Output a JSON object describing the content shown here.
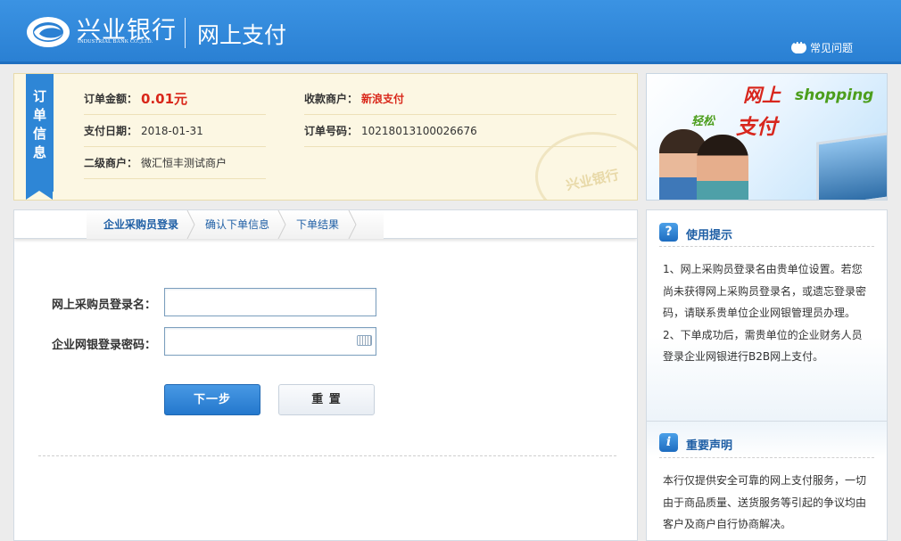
{
  "header": {
    "logo_cn": "兴业银行",
    "logo_en": "INDUSTRIAL BANK CO.,LTD.",
    "title": "网上支付",
    "help_label": "常见问题"
  },
  "order": {
    "ribbon_label": "订单信息",
    "amount_label": "订单金额：",
    "amount_value": "0.01元",
    "merchant_label": "收款商户：",
    "merchant_value": "新浪支付",
    "date_label": "支付日期：",
    "date_value": "2018-01-31",
    "order_no_label": "订单号码：",
    "order_no_value": "10218013100026676",
    "sub_merchant_label": "二级商户：",
    "sub_merchant_value": "微汇恒丰测试商户",
    "stamp_text": "兴业银行"
  },
  "banner": {
    "line1_cn": "网上",
    "line1_en": "shopping",
    "line2_small": "轻松",
    "line2_big": "支付"
  },
  "tabs": [
    {
      "label": "企业采购员登录",
      "active": true
    },
    {
      "label": "确认下单信息",
      "active": false
    },
    {
      "label": "下单结果",
      "active": false
    }
  ],
  "form": {
    "username_label": "网上采购员登录名：",
    "username_value": "",
    "password_label": "企业网银登录密码：",
    "password_value": "",
    "next_button": "下一步",
    "reset_button": "重 置"
  },
  "tips": {
    "title": "使用提示",
    "icon": "question-icon",
    "lines": [
      "1、网上采购员登录名由贵单位设置。若您",
      "尚未获得网上采购员登录名，或遗忘登录密",
      "码，请联系贵单位企业网银管理员办理。",
      "2、下单成功后，需贵单位的企业财务人员",
      "登录企业网银进行B2B网上支付。"
    ]
  },
  "notice": {
    "title": "重要声明",
    "icon": "info-icon",
    "lines": [
      "本行仅提供安全可靠的网上支付服务，一切",
      "由于商品质量、送货服务等引起的争议均由",
      "客户及商户自行协商解决。"
    ]
  },
  "colors": {
    "header_blue": "#2a80d3",
    "accent_red": "#d9271a",
    "link_blue": "#1f5fa5",
    "order_bg": "#fcf7e3"
  }
}
